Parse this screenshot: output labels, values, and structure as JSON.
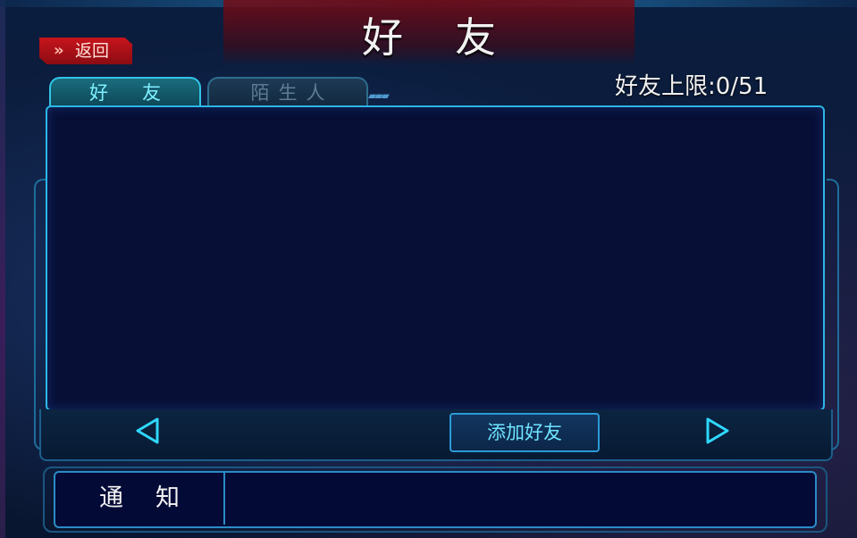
{
  "header": {
    "title": "好友",
    "back_label": "返回",
    "back_icon": "double-chevron-right-icon"
  },
  "tabs": [
    {
      "label": "好友",
      "active": true
    },
    {
      "label": "陌生人",
      "active": false
    }
  ],
  "friend_limit": {
    "text": "好友上限:0/51",
    "current": 0,
    "max": 51
  },
  "friend_list": {
    "items": []
  },
  "nav": {
    "prev_icon": "triangle-left-icon",
    "next_icon": "triangle-right-icon",
    "add_friend_label": "添加好友"
  },
  "notice": {
    "label": "通知",
    "text": ""
  },
  "colors": {
    "accent_cyan": "#2bb6e6",
    "title_red": "#c8141c",
    "list_background": "#070f37"
  }
}
